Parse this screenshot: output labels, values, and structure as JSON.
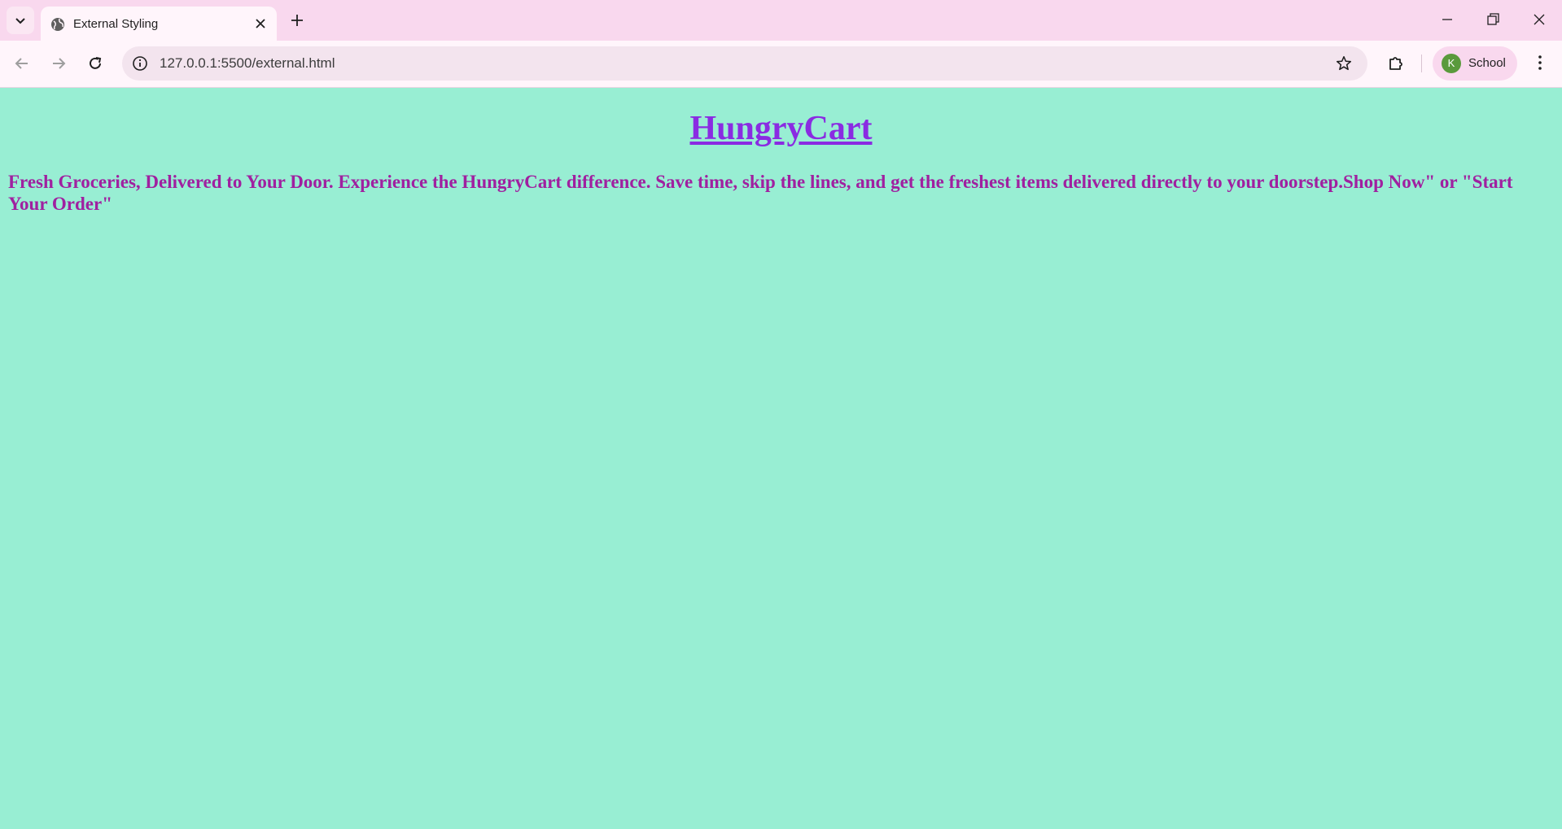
{
  "browser": {
    "tab_title": "External Styling",
    "url": "127.0.0.1:5500/external.html",
    "profile_initial": "K",
    "profile_label": "School"
  },
  "page": {
    "heading": "HungryCart",
    "tagline": "Fresh Groceries, Delivered to Your Door. Experience the HungryCart difference. Save time, skip the lines, and get the freshest items delivered directly to your doorstep.Shop Now\" or \"Start Your Order\""
  },
  "icons": {
    "tab_search": "chevron-down-icon",
    "tab_favicon": "globe-icon",
    "tab_close": "close-icon",
    "new_tab": "plus-icon",
    "back": "arrow-left-icon",
    "forward": "arrow-right-icon",
    "reload": "reload-icon",
    "site_info": "info-icon",
    "bookmark": "star-icon",
    "extensions": "puzzle-icon",
    "menu": "kebab-menu-icon",
    "minimize": "minimize-icon",
    "restore": "restore-icon",
    "close_window": "close-icon"
  },
  "colors": {
    "page_background": "#98eed3",
    "heading": "#8a2be2",
    "tagline": "#a020a0",
    "chrome": "#f9d8ee"
  }
}
